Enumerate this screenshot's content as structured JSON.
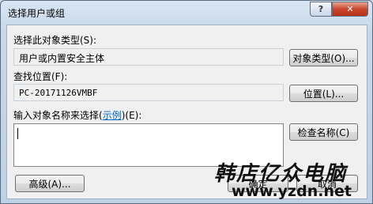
{
  "window": {
    "title": "选择用户或组",
    "help_glyph": "?",
    "close_glyph": "✕"
  },
  "object_type": {
    "label": "选择此对象类型(S):",
    "value": "用户或内置安全主体",
    "button": "对象类型(O)..."
  },
  "location": {
    "label": "查找位置(F):",
    "value": "PC-20171126VMBF",
    "button": "位置(L)..."
  },
  "names": {
    "label_prefix": "输入对象名称来选择(",
    "label_link": "示例",
    "label_suffix": ")(E):",
    "value": "",
    "check_button": "检查名称(C)"
  },
  "footer": {
    "advanced_button": "高级(A)...",
    "ok_button": "确定",
    "cancel_button": "取消"
  },
  "watermark": {
    "line1": "韩店亿众电脑",
    "line2": "www.yzdn.net"
  },
  "colors": {
    "close_button": "#c8452b",
    "link": "#0066cc",
    "window_frame": "#cfdcea"
  }
}
